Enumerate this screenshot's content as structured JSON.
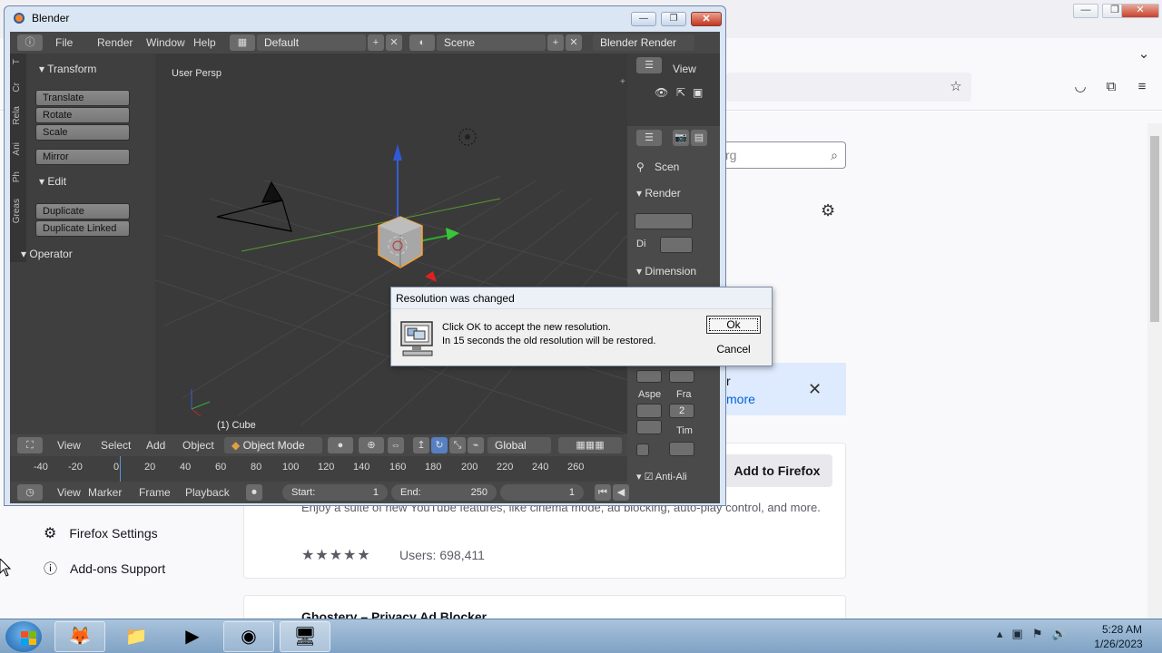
{
  "blender": {
    "title": "Blender",
    "menu": [
      "File",
      "Render",
      "Window",
      "Help"
    ],
    "layout_name": "Default",
    "scene_name": "Scene",
    "render_engine": "Blender Render",
    "tools_tabs": [
      "T",
      "Cr",
      "Rela",
      "Ani",
      "Ph",
      "Greas"
    ],
    "transform_header": "Transform",
    "transform_buttons": [
      "Translate",
      "Rotate",
      "Scale"
    ],
    "mirror_button": "Mirror",
    "edit_header": "Edit",
    "edit_buttons": [
      "Duplicate",
      "Duplicate Linked"
    ],
    "operator_header": "Operator",
    "viewport_label": "User Persp",
    "active_object": "(1) Cube",
    "outliner_view": "View",
    "props_scene": "Scen",
    "props_render": "Render",
    "props_dimensions": "Dimension",
    "props_di": "Di",
    "props_aspect": "Aspe",
    "props_frame": "Fra",
    "props_frame_value": "2",
    "props_time": "Tim",
    "props_antialias": "Anti-Ali",
    "view3d_menu": [
      "View",
      "Select",
      "Add",
      "Object"
    ],
    "mode": "Object Mode",
    "orientation": "Global",
    "timeline_ticks": [
      "-40",
      "-20",
      "0",
      "20",
      "40",
      "60",
      "80",
      "100",
      "120",
      "140",
      "160",
      "180",
      "200",
      "220",
      "240",
      "260"
    ],
    "timeline_menu": [
      "View",
      "Marker",
      "Frame",
      "Playback"
    ],
    "start_label": "Start:",
    "start_value": "1",
    "end_label": "End:",
    "end_value": "250",
    "current_frame": "1"
  },
  "dialog": {
    "title": "Resolution was changed",
    "message_line1": "Click OK to accept the new resolution.",
    "message_line2": "In 15 seconds the old resolution will be restored.",
    "ok_label": "Ok",
    "cancel_label": "Cancel"
  },
  "firefox": {
    "search_placeholder_fragment": "rg",
    "notice_link": "more",
    "notice_fragment": "r",
    "add_button": "Add to Firefox",
    "addon_description": "Enjoy a suite of new YouTube features, like cinema mode, ad blocking, auto-play control, and more.",
    "rating_stars": "★★★★★",
    "users": "Users: 698,411",
    "next_addon_title": "Ghostery – Privacy Ad Blocker",
    "settings_link": "Firefox Settings",
    "support_link": "Add-ons Support"
  },
  "taskbar": {
    "apps": [
      "firefox-icon",
      "file-explorer-icon",
      "media-player-icon",
      "blender-icon",
      "display-settings-icon"
    ],
    "time": "5:28 AM",
    "date": "1/26/2023"
  }
}
